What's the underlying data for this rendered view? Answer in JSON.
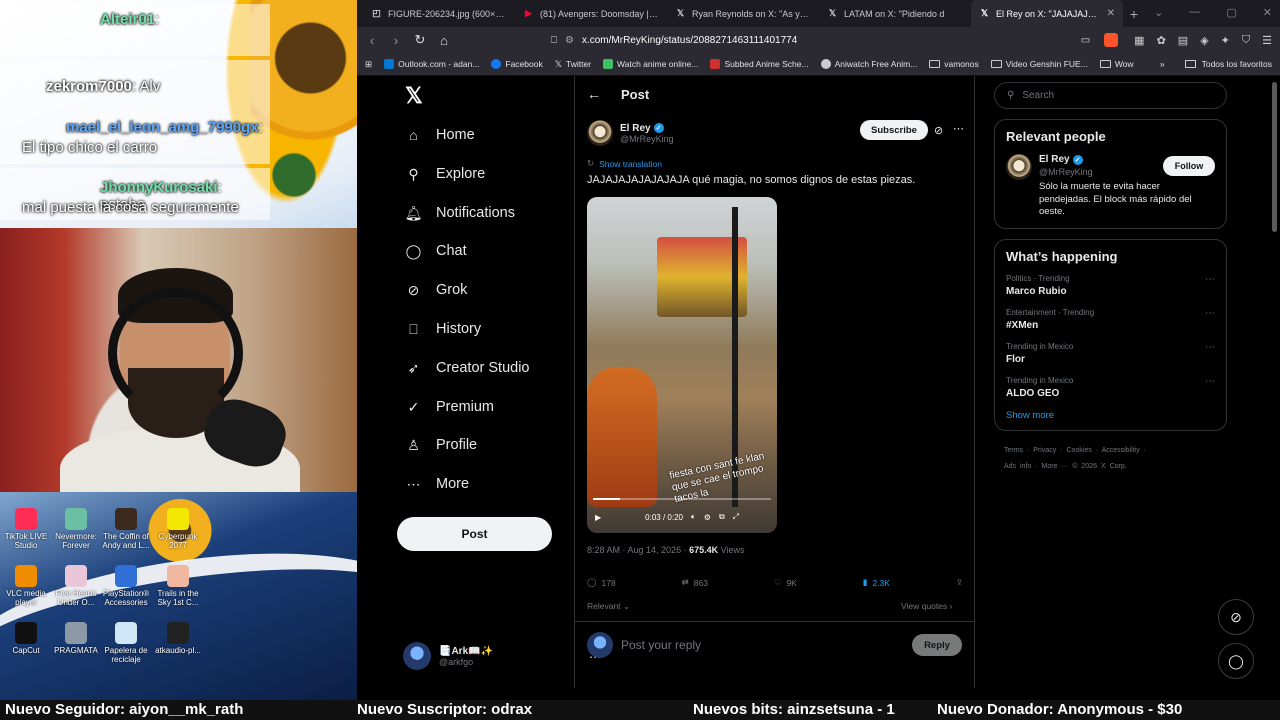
{
  "stream": {
    "chat": [
      {
        "user": "Alteir01",
        "msg": ":"
      },
      {
        "user": "zekrom7000",
        "msg": ": Alv"
      },
      {
        "user": "mael_el_leon_amg_7990gx",
        "msg": ":"
      },
      {
        "user": "",
        "msg": "El tipo chico el carro"
      },
      {
        "user": "JhonnyKurosaki",
        "msg": ": estaba"
      },
      {
        "user": "",
        "msg": "mal puesta la cosa seguramente"
      }
    ],
    "desktop_icons": [
      {
        "label": "TikTok LIVE Studio"
      },
      {
        "label": "Nevermore: Forever"
      },
      {
        "label": "The Coffin of Andy and L..."
      },
      {
        "label": "Cyberpunk 2077"
      },
      {
        "label": "VLC media player"
      },
      {
        "label": "Five Hearts Under O..."
      },
      {
        "label": "PlayStation® Accessories"
      },
      {
        "label": "Trails in the Sky 1st C..."
      },
      {
        "label": "CapCut"
      },
      {
        "label": "PRAGMATA"
      },
      {
        "label": "Papelera de reciclaje"
      },
      {
        "label": "atkaudio-pl..."
      }
    ]
  },
  "browser": {
    "tabs": [
      {
        "title": "FIGURE-206234.jpg (600×600)",
        "icon": "image-icon",
        "active": false
      },
      {
        "title": "(81) Avengers: Doomsday | Spec",
        "icon": "youtube-icon",
        "active": false
      },
      {
        "title": "Ryan Reynolds on X: \"As you kno",
        "icon": "x-icon",
        "active": false
      },
      {
        "title": "LATAM  on X: \"Pidiendo d",
        "icon": "x-icon",
        "active": false
      },
      {
        "title": "El Rey on X: \"JAJAJAJAJAJAJ",
        "icon": "x-icon",
        "active": true
      }
    ],
    "url": "x.com/MrReyKing/status/2088271463111401774",
    "bookmarks": [
      {
        "label": "Outlook.com - adan...",
        "color": "#0078d4"
      },
      {
        "label": "Facebook",
        "color": "#1877f2"
      },
      {
        "label": "Twitter",
        "color": "#000000"
      },
      {
        "label": "Watch anime online...",
        "color": "#3fbf5f"
      },
      {
        "label": "Subbed Anime Sche...",
        "color": "#d0312d"
      },
      {
        "label": "Aniwatch Free Anim...",
        "color": "#cccccc"
      },
      {
        "label": "vamonos",
        "color": "folder"
      },
      {
        "label": "Video Genshin FUE...",
        "color": "folder"
      },
      {
        "label": "Wow",
        "color": "folder"
      }
    ],
    "bookmarks_right": "Todos los favoritos"
  },
  "xnav": {
    "items": [
      {
        "label": "Home",
        "icon": "home-icon"
      },
      {
        "label": "Explore",
        "icon": "search-icon"
      },
      {
        "label": "Notifications",
        "icon": "bell-icon"
      },
      {
        "label": "Chat",
        "icon": "chat-icon"
      },
      {
        "label": "Grok",
        "icon": "grok-icon"
      },
      {
        "label": "History",
        "icon": "bookmark-icon"
      },
      {
        "label": "Creator Studio",
        "icon": "rocket-icon"
      },
      {
        "label": "Premium",
        "icon": "premium-icon"
      },
      {
        "label": "Profile",
        "icon": "person-icon"
      },
      {
        "label": "More",
        "icon": "more-icon"
      }
    ],
    "post_button": "Post",
    "me": {
      "name": "📑Ark📖✨",
      "handle": "@arkfgo"
    }
  },
  "post": {
    "header": "Post",
    "author": {
      "name": "El Rey",
      "handle": "@MrReyKing"
    },
    "subscribe": "Subscribe",
    "show_translation": "Show translation",
    "text": "JAJAJAJAJAJAJAJA qué magia, no somos dignos de estas piezas.",
    "video": {
      "caption": "fiesta con sant fe klan que se cae el trompo tacos la",
      "time": "0:03 / 0:20",
      "progress": 0.15
    },
    "timestamp": "8:28 AM · Aug 14, 2026 · ",
    "views_count": "675.4K",
    "views_label": " Views",
    "stats": {
      "replies": "178",
      "reposts": "863",
      "likes": "9K",
      "bookmarks": "2.3K"
    },
    "sort": "Relevant",
    "view_quotes": "View quotes",
    "reply_placeholder": "Post your reply",
    "reply_button": "Reply"
  },
  "sidebar": {
    "search_placeholder": "Search",
    "relevant_title": "Relevant people",
    "person": {
      "name": "El Rey",
      "handle": "@MrReyKing",
      "bio": "Sólo la muerte te evita hacer pendejadas. El block más rápido del oeste.",
      "follow": "Follow"
    },
    "happening_title": "What’s happening",
    "trends": [
      {
        "context": "Politics · Trending",
        "name": "Marco Rubio"
      },
      {
        "context": "Entertainment · Trending",
        "name": "#XMen"
      },
      {
        "context": "Trending in Mexico",
        "name": "Flor"
      },
      {
        "context": "Trending in Mexico",
        "name": "ALDO GEO"
      }
    ],
    "show_more": "Show more",
    "footer_line1": "Terms · Privacy · Cookies · Accessibility ·",
    "footer_line2": "Ads info · More ··· © 2026 X Corp."
  },
  "ticker": {
    "follower": "Nuevo Seguidor: aiyon__mk_rath",
    "subscriber": "Nuevo Suscriptor: odrax",
    "bits": "Nuevos bits: ainzsetsuna - 1",
    "donor": "Nuevo Donador: Anonymous - $30"
  },
  "colors": {
    "accent": "#1d9bf0",
    "background": "#000000",
    "border": "#2f3336"
  }
}
